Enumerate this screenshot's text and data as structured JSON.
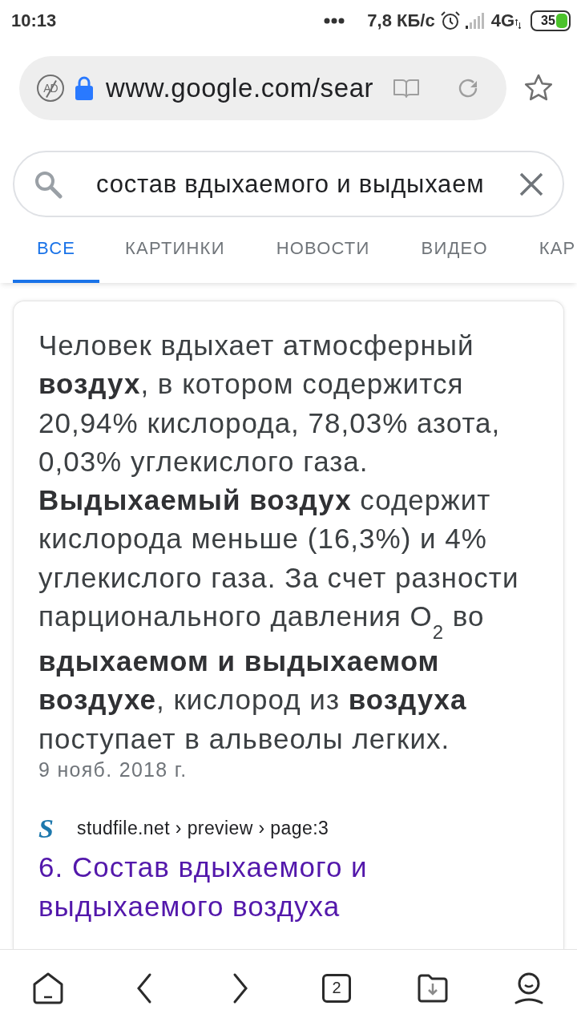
{
  "status_bar": {
    "time": "10:13",
    "speed": "7,8 КБ/с",
    "network": "4G",
    "battery": "35"
  },
  "address_bar": {
    "adblock_label": "AD",
    "url": "www.google.com/sear"
  },
  "search": {
    "value": "состав вдыхаемого и выдыхаем"
  },
  "tabs": [
    {
      "label": "ВСЕ",
      "selected": true
    },
    {
      "label": "КАРТИНКИ",
      "selected": false
    },
    {
      "label": "НОВОСТИ",
      "selected": false
    },
    {
      "label": "ВИДЕО",
      "selected": false
    },
    {
      "label": "КАР",
      "selected": false
    }
  ],
  "featured_snippet": {
    "text": "Человек вдыхает атмосферный **воздух**, в котором содержится 20,94% кислорода, 78,03% азота, 0,03% углекислого газа. **Выдыхаемый воздух** содержит кислорода меньше (16,3%) и 4% углекислого газа. За счет разности парционального давления O$_{2}$ во **вдыхаемом и выдыхаемом воздухе**, кислород из **воздуха** поступает в альвеолы легких.",
    "date": "9 нояб. 2018 г.",
    "favicon_letter": "S",
    "breadcrumb": "studfile.net › preview › page:3",
    "title": "6. Состав вдыхаемого и выдыхаемого воздуха"
  },
  "bottom_bar": {
    "tab_count": "2"
  }
}
